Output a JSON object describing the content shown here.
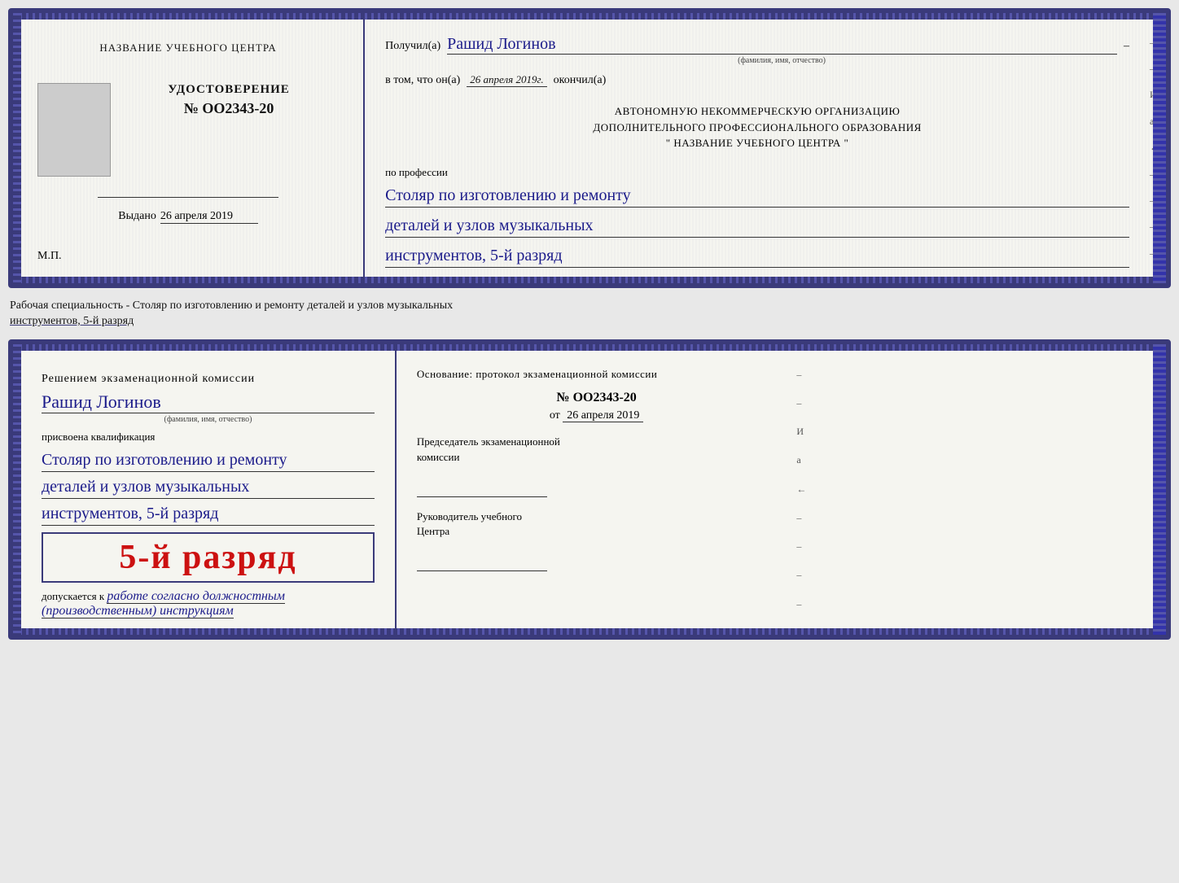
{
  "doc1": {
    "left": {
      "center_title": "НАЗВАНИЕ УЧЕБНОГО ЦЕНТРА",
      "udostoverenie_label": "УДОСТОВЕРЕНИЕ",
      "number": "№ OO2343-20",
      "vydano_label": "Выдано",
      "vydano_date": "26 апреля 2019",
      "mp_label": "М.П."
    },
    "right": {
      "poluchil_label": "Получил(а)",
      "recipient_name": "Рашид Логинов",
      "fio_label": "(фамилия, имя, отчество)",
      "dash": "–",
      "vtom_label": "в том, что он(а)",
      "vtom_date": "26 апреля 2019г.",
      "okonchil_label": "окончил(а)",
      "org_line1": "АВТОНОМНУЮ НЕКОММЕРЧЕСКУЮ ОРГАНИЗАЦИЮ",
      "org_line2": "ДОПОЛНИТЕЛЬНОГО ПРОФЕССИОНАЛЬНОГО ОБРАЗОВАНИЯ",
      "org_line3": "\"    НАЗВАНИЕ УЧЕБНОГО ЦЕНТРА    \"",
      "po_professii": "по профессии",
      "prof_line1": "Столяр по изготовлению и ремонту",
      "prof_line2": "деталей и узлов музыкальных",
      "prof_line3": "инструментов, 5-й разряд"
    }
  },
  "between_label": {
    "line1": "Рабочая специальность - Столяр по изготовлению и ремонту деталей и узлов музыкальных",
    "line2_underline": "инструментов, 5-й разряд"
  },
  "doc2": {
    "left": {
      "komissia_header": "Решением  экзаменационной  комиссии",
      "name": "Рашид Логинов",
      "fio_label": "(фамилия, имя, отчество)",
      "prisvoena": "присвоена квалификация",
      "qual_line1": "Столяр по изготовлению и ремонту",
      "qual_line2": "деталей и узлов музыкальных",
      "qual_line3": "инструментов, 5-й разряд",
      "rank_big": "5-й разряд",
      "dopuskaetsya_label": "допускается к",
      "dopuskaetsya_value": "работе согласно должностным",
      "dopuskaetsya_value2": "(производственным) инструкциям"
    },
    "right": {
      "osnovanie_label": "Основание:  протокол  экзаменационной  комиссии",
      "protocol_number": "№  OO2343-20",
      "ot_label": "от",
      "ot_date": "26 апреля 2019",
      "predsedatel_label": "Председатель экзаменационной",
      "komissii_label": "комиссии",
      "rukovoditel_label": "Руководитель учебного",
      "centra_label": "Центра"
    }
  },
  "dashes": [
    "–",
    "–",
    "И",
    "а",
    "←",
    "–",
    "–",
    "–",
    "–"
  ]
}
